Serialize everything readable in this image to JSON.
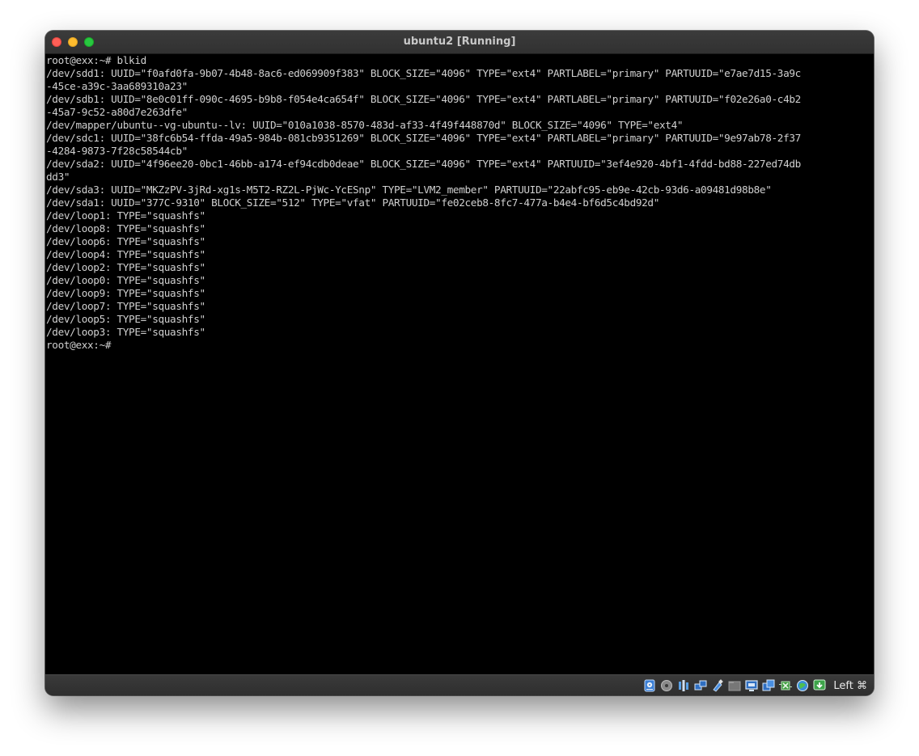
{
  "window": {
    "title": "ubuntu2 [Running]"
  },
  "terminal": {
    "lines": [
      "root@exx:~# blkid",
      "/dev/sdd1: UUID=\"f0afd0fa-9b07-4b48-8ac6-ed069909f383\" BLOCK_SIZE=\"4096\" TYPE=\"ext4\" PARTLABEL=\"primary\" PARTUUID=\"e7ae7d15-3a9c",
      "-45ce-a39c-3aa689310a23\"",
      "/dev/sdb1: UUID=\"8e0c01ff-090c-4695-b9b8-f054e4ca654f\" BLOCK_SIZE=\"4096\" TYPE=\"ext4\" PARTLABEL=\"primary\" PARTUUID=\"f02e26a0-c4b2",
      "-45a7-9c52-a80d7e263dfe\"",
      "/dev/mapper/ubuntu--vg-ubuntu--lv: UUID=\"010a1038-8570-483d-af33-4f49f448870d\" BLOCK_SIZE=\"4096\" TYPE=\"ext4\"",
      "/dev/sdc1: UUID=\"38fc6b54-ffda-49a5-984b-081cb9351269\" BLOCK_SIZE=\"4096\" TYPE=\"ext4\" PARTLABEL=\"primary\" PARTUUID=\"9e97ab78-2f37",
      "-4284-9873-7f28c58544cb\"",
      "/dev/sda2: UUID=\"4f96ee20-0bc1-46bb-a174-ef94cdb0deae\" BLOCK_SIZE=\"4096\" TYPE=\"ext4\" PARTUUID=\"3ef4e920-4bf1-4fdd-bd88-227ed74db",
      "dd3\"",
      "/dev/sda3: UUID=\"MKZzPV-3jRd-xg1s-M5T2-RZ2L-PjWc-YcESnp\" TYPE=\"LVM2_member\" PARTUUID=\"22abfc95-eb9e-42cb-93d6-a09481d98b8e\"",
      "/dev/sda1: UUID=\"377C-9310\" BLOCK_SIZE=\"512\" TYPE=\"vfat\" PARTUUID=\"fe02ceb8-8fc7-477a-b4e4-bf6d5c4bd92d\"",
      "/dev/loop1: TYPE=\"squashfs\"",
      "/dev/loop8: TYPE=\"squashfs\"",
      "/dev/loop6: TYPE=\"squashfs\"",
      "/dev/loop4: TYPE=\"squashfs\"",
      "/dev/loop2: TYPE=\"squashfs\"",
      "/dev/loop0: TYPE=\"squashfs\"",
      "/dev/loop9: TYPE=\"squashfs\"",
      "/dev/loop7: TYPE=\"squashfs\"",
      "/dev/loop5: TYPE=\"squashfs\"",
      "/dev/loop3: TYPE=\"squashfs\"",
      "root@exx:~#"
    ]
  },
  "statusbar": {
    "icons": [
      "hard-disk-icon",
      "optical-drive-icon",
      "audio-icon",
      "network-icon",
      "usb-icon",
      "shared-folders-icon",
      "display-icon",
      "video-capture-icon",
      "cpu-icon",
      "mouse-integration-icon",
      "keyboard-capture-icon"
    ],
    "host_key": "Left ⌘"
  },
  "colors": {
    "terminal_bg": "#000000",
    "terminal_fg": "#d0d0d0",
    "titlebar_bg": "#353535",
    "close": "#ff5f57",
    "minimize": "#febc2e",
    "maximize": "#28c840"
  }
}
